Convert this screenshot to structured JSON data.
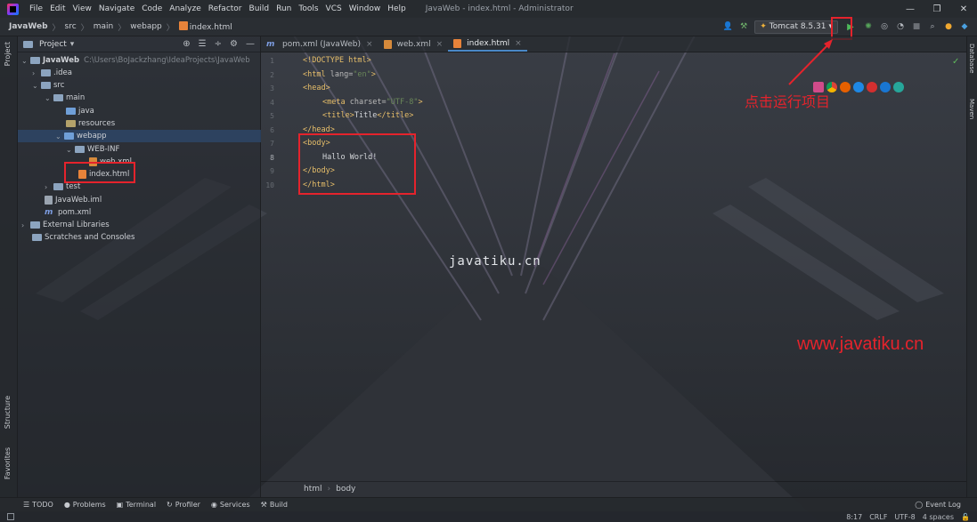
{
  "app": {
    "menu": [
      "File",
      "Edit",
      "View",
      "Navigate",
      "Code",
      "Analyze",
      "Refactor",
      "Build",
      "Run",
      "Tools",
      "VCS",
      "Window",
      "Help"
    ],
    "window_title": "JavaWeb - index.html - Administrator",
    "win_controls": [
      "—",
      "❐",
      "✕"
    ]
  },
  "breadcrumbs": [
    "JavaWeb",
    "src",
    "main",
    "webapp",
    "index.html"
  ],
  "run_config": {
    "name": "Tomcat 8.5.31",
    "run_label": "▶"
  },
  "left_strip": {
    "project": "Project",
    "structure": "Structure",
    "favorites": "Favorites"
  },
  "right_strip": {
    "database": "Database",
    "maven": "Maven"
  },
  "project_panel": {
    "title": "Project",
    "tree": [
      {
        "label": "JavaWeb",
        "extra": "C:\\Users\\BoJackzhang\\IdeaProjects\\JavaWeb",
        "kind": "module"
      },
      {
        "label": ".idea",
        "kind": "folder"
      },
      {
        "label": "src",
        "kind": "folder"
      },
      {
        "label": "main",
        "kind": "folder"
      },
      {
        "label": "java",
        "kind": "folder-blue"
      },
      {
        "label": "resources",
        "kind": "folder-res"
      },
      {
        "label": "webapp",
        "kind": "folder-blue"
      },
      {
        "label": "WEB-INF",
        "kind": "folder"
      },
      {
        "label": "web.xml",
        "kind": "xml"
      },
      {
        "label": "index.html",
        "kind": "html"
      },
      {
        "label": "test",
        "kind": "folder"
      },
      {
        "label": "JavaWeb.iml",
        "kind": "iml"
      },
      {
        "label": "pom.xml",
        "kind": "m"
      },
      {
        "label": "External Libraries",
        "kind": "lib"
      },
      {
        "label": "Scratches and Consoles",
        "kind": "scratch"
      }
    ]
  },
  "tabs": [
    {
      "label": "pom.xml (JavaWeb)",
      "kind": "m",
      "active": false
    },
    {
      "label": "web.xml",
      "kind": "xml",
      "active": false
    },
    {
      "label": "index.html",
      "kind": "html",
      "active": true
    }
  ],
  "editor": {
    "line_numbers": [
      "1",
      "2",
      "3",
      "4",
      "5",
      "6",
      "7",
      "8",
      "9",
      "10"
    ],
    "lines": {
      "l1": "<!DOCTYPE html>",
      "l2_open": "<html ",
      "l2_attr": "lang=",
      "l2_str": "\"en\"",
      "l2_close": ">",
      "l3": "<head>",
      "l4_open": "<meta ",
      "l4_attr": "charset=",
      "l4_str": "\"UTF-8\"",
      "l4_close": ">",
      "l5_open": "<title>",
      "l5_text": "Title",
      "l5_close": "</title>",
      "l6": "</head>",
      "l7": "<body>",
      "l8": "Hallo World!",
      "l9": "</body>",
      "l10": "</html>"
    },
    "crumbs": [
      "html",
      "body"
    ]
  },
  "annotation": "点击运行项目",
  "watermark_center": "javatiku.cn",
  "watermark_corner": "www.javatiku.cn",
  "bottom_tools": [
    "TODO",
    "Problems",
    "Terminal",
    "Profiler",
    "Services",
    "Build"
  ],
  "event_log": "Event Log",
  "status": {
    "position": "8:17",
    "line_sep": "CRLF",
    "encoding": "UTF-8",
    "indent": "4 spaces"
  },
  "colors": {
    "highlight_red": "#e5232c",
    "run_green": "#4fb85a",
    "selection": "#2e496e"
  }
}
